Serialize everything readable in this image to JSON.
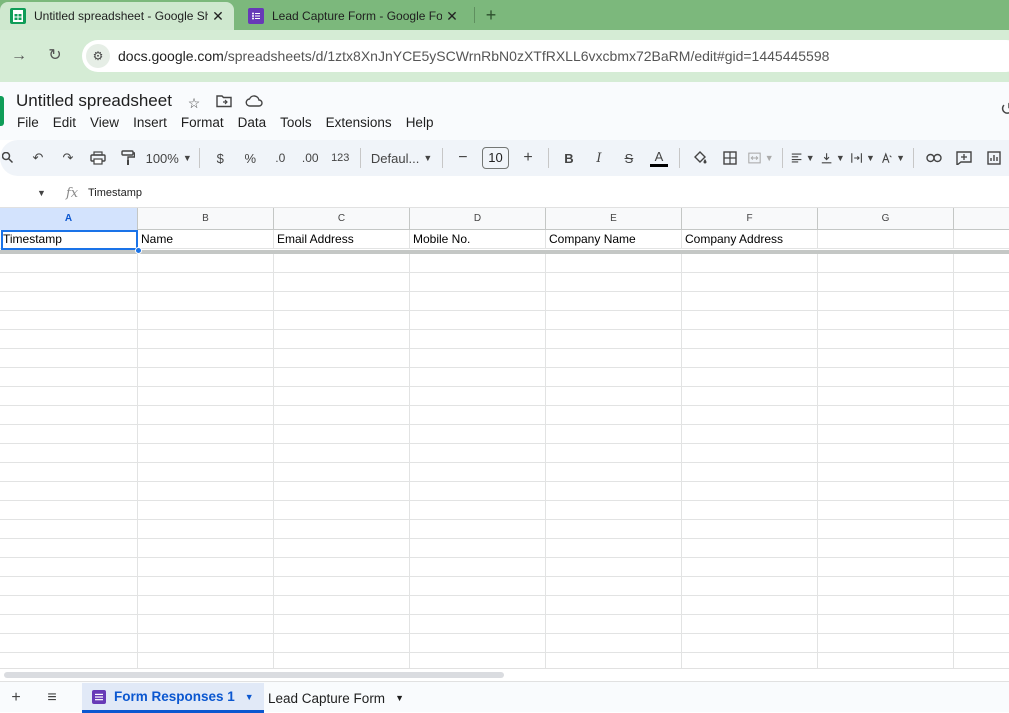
{
  "browser": {
    "tabs": [
      {
        "title": "Untitled spreadsheet - Google Sheets",
        "icon": "google-sheets-favicon",
        "active": true,
        "close": "✕"
      },
      {
        "title": "Lead Capture Form - Google Forms",
        "icon": "google-forms-favicon",
        "active": false,
        "close": "✕"
      }
    ],
    "new_tab": "+",
    "url_host": "docs.google.com",
    "url_path": "/spreadsheets/d/1ztx8XnJnYCE5ySCWrnRbN0zXTfRXLL6vxcbmx72BaRM/edit#gid=1445445598"
  },
  "doc": {
    "title": "Untitled spreadsheet",
    "menus": [
      "File",
      "Edit",
      "View",
      "Insert",
      "Format",
      "Data",
      "Tools",
      "Extensions",
      "Help"
    ]
  },
  "toolbar": {
    "zoom": "100%",
    "currency": "$",
    "percent": "%",
    "decrease_decimal": ".0",
    "increase_decimal": ".00",
    "number_format": "123",
    "font": "Defaul...",
    "font_size": "10",
    "minus": "−",
    "plus": "+",
    "bold": "B",
    "italic": "I",
    "strike": "S",
    "text_color": "A",
    "text_color_value": "#000000"
  },
  "formula_bar": {
    "fx": "fx",
    "content": "Timestamp"
  },
  "grid": {
    "columns": [
      "A",
      "B",
      "C",
      "D",
      "E",
      "F",
      "G"
    ],
    "selected_column": "A",
    "header_row": [
      "Timestamp",
      "Name",
      "Email Address",
      "Mobile No.",
      "Company Name",
      "Company Address",
      ""
    ]
  },
  "sheets": {
    "add": "+",
    "all_sheets": "≡",
    "tabs": [
      {
        "label": "Form Responses 1",
        "active": true
      },
      {
        "label": "Lead Capture Form",
        "active": false
      }
    ]
  },
  "colors": {
    "accent": "#0b57d0",
    "sheets_green": "#0f9d58",
    "forms_purple": "#673ab7",
    "chrome_frame": "#7cb87c"
  }
}
